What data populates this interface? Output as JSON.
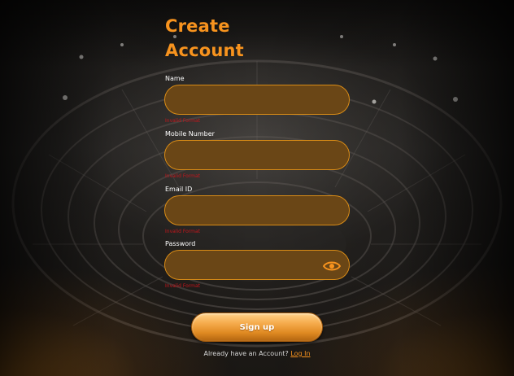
{
  "page": {
    "title_line1": "Create",
    "title_line2": "Account"
  },
  "form": {
    "name": {
      "label": "Name",
      "value": "",
      "error": "Invalid Format"
    },
    "mobile": {
      "label": "Mobile Number",
      "value": "",
      "error": "Invalid Format"
    },
    "email": {
      "label": "Email ID",
      "value": "",
      "error": "Invalid Format"
    },
    "password": {
      "label": "Password",
      "value": "",
      "error": "Invalid Format",
      "toggle_icon": "eye-icon"
    },
    "submit_label": "Sign up"
  },
  "footer": {
    "prompt": "Already have an Account?",
    "login_link": "Log In"
  },
  "colors": {
    "accent": "#f7931e",
    "field_bg": "#6a4616",
    "field_border": "#d88b16",
    "error": "#c4161c"
  }
}
